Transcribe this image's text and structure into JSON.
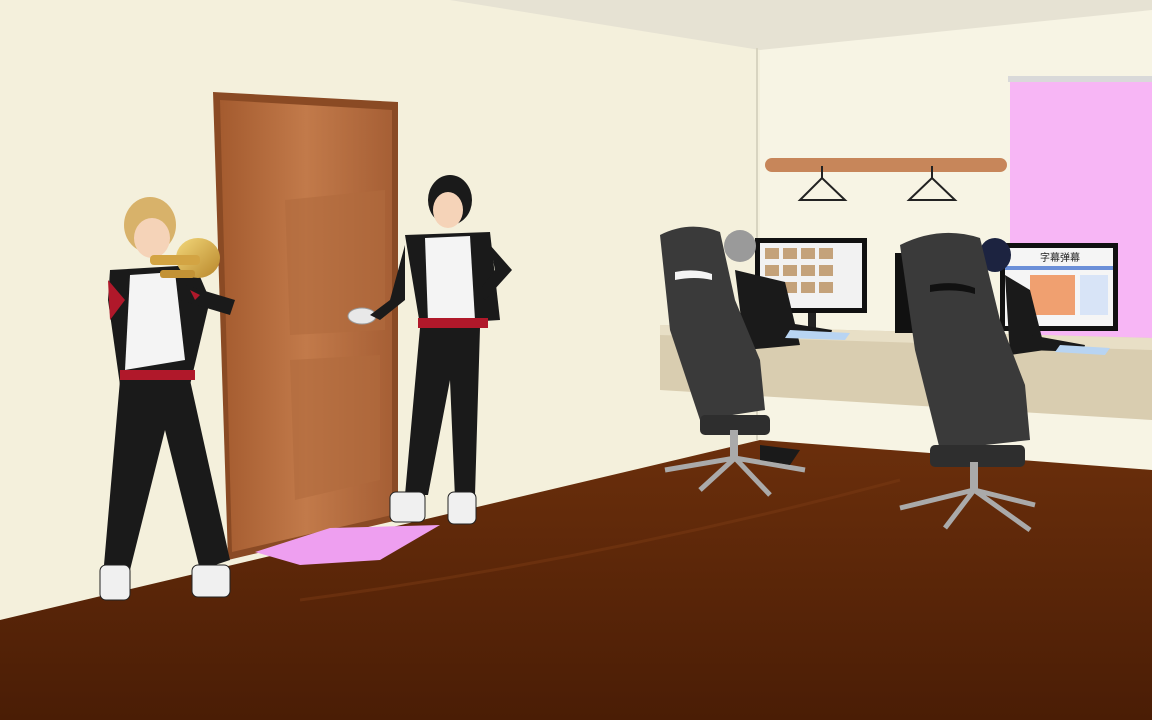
{
  "scene": {
    "description_title": "",
    "monitor_right_header": "字幕弹幕"
  },
  "colors": {
    "wall": "#f4f0dc",
    "floor": "#5a2608",
    "door": "#b46a3c",
    "jacket_red": "#b0182a",
    "curtain_pink": "#f7b6f5"
  }
}
